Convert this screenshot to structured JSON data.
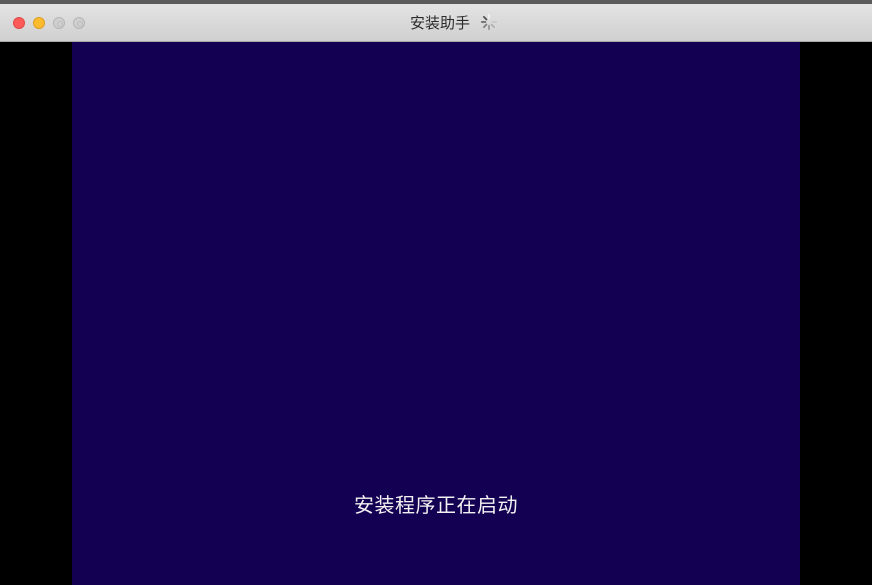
{
  "window": {
    "title": "安装助手",
    "title_icon": "loading-spinner-icon"
  },
  "titlebar_buttons": [
    {
      "name": "close-button",
      "icon": "close-icon",
      "color": "#fc5b57"
    },
    {
      "name": "minimize-button",
      "icon": "minimize-icon",
      "color": "#fdbb2e"
    },
    {
      "name": "zoom-button",
      "icon": "zoom-icon",
      "color": "#cfcfcf"
    },
    {
      "name": "fullscreen-button",
      "icon": "fullscreen-icon",
      "color": "#cfcfcf"
    }
  ],
  "installer": {
    "status_text": "安装程序正在启动",
    "background_color": "#130052",
    "letterbox_color": "#000000"
  }
}
